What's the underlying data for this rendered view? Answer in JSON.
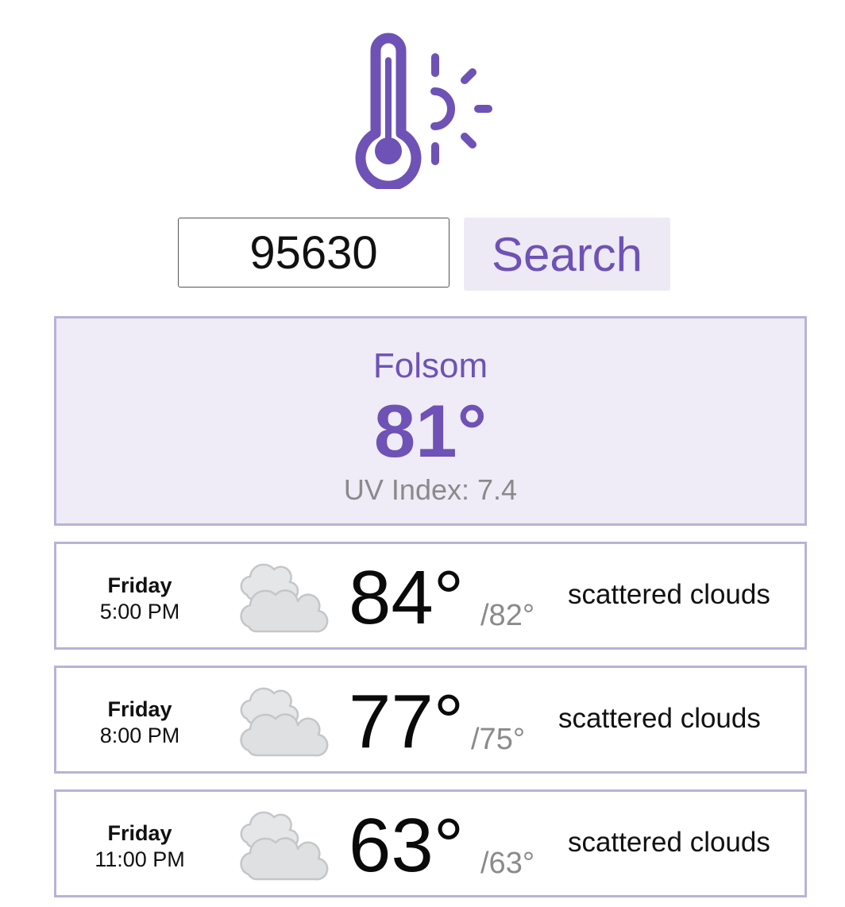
{
  "logo": {
    "icon": "thermometer-sun-icon",
    "color": "#6e52b5"
  },
  "search": {
    "zip_value": "95630",
    "button_label": "Search"
  },
  "current": {
    "city": "Folsom",
    "temp": "81°",
    "uv": "UV Index: 7.4"
  },
  "forecast": [
    {
      "day": "Friday",
      "time": "5:00 PM",
      "icon": "scattered-clouds-icon",
      "temp": "84°",
      "low": "/82°",
      "desc": "scattered clouds"
    },
    {
      "day": "Friday",
      "time": "8:00 PM",
      "icon": "scattered-clouds-icon",
      "temp": "77°",
      "low": "/75°",
      "desc": "scattered clouds"
    },
    {
      "day": "Friday",
      "time": "11:00 PM",
      "icon": "scattered-clouds-icon",
      "temp": "63°",
      "low": "/63°",
      "desc": "scattered clouds"
    }
  ],
  "colors": {
    "accent": "#6e52b5",
    "panel_bg": "#efebf7",
    "border": "#b8b3d8"
  }
}
